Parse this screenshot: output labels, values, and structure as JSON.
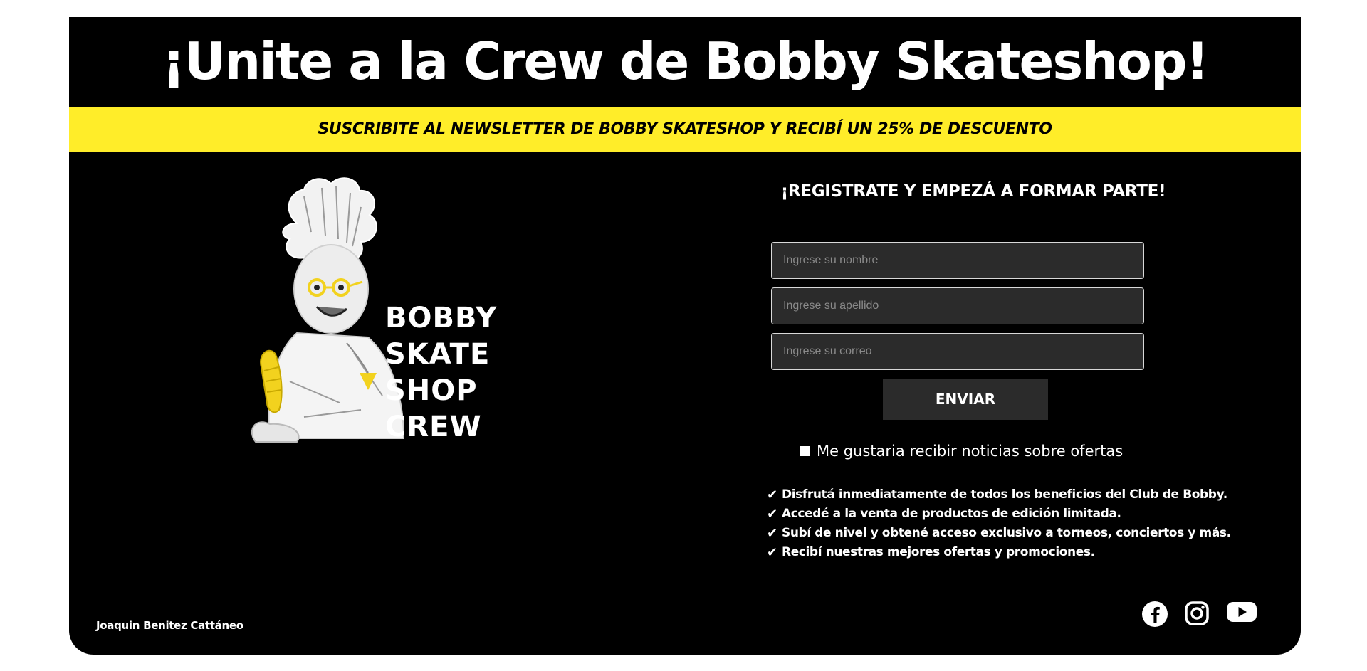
{
  "header": {
    "title": "¡Unite a la Crew de Bobby Skateshop!"
  },
  "banner": {
    "text": "SUSCRIBITE AL NEWSLETTER DE BOBBY SKATESHOP Y RECIBÍ UN 25% DE DESCUENTO",
    "color": "#FFED29"
  },
  "logo": {
    "lines": [
      "BOBBY",
      "SKATE",
      "SHOP",
      "CREW"
    ],
    "accent_color": "#F2D21E"
  },
  "form": {
    "title": "¡REGISTRATE Y EMPEZÁ A FORMAR PARTE!",
    "fields": [
      {
        "placeholder": "Ingrese su nombre",
        "value": ""
      },
      {
        "placeholder": "Ingrese su apellido",
        "value": ""
      },
      {
        "placeholder": "Ingrese su correo",
        "value": ""
      }
    ],
    "submit_label": "ENVIAR",
    "optin_label": "Me gustaria recibir noticias sobre ofertas",
    "optin_checked": false
  },
  "benefits": [
    "Disfrutá inmediatamente de todos los beneficios del Club de Bobby.",
    "Accedé a la venta de productos de edición limitada.",
    "Subí de nivel y obtené acceso exclusivo a torneos, conciertos y más.",
    "Recibí nuestras mejores ofertas y promociones."
  ],
  "footer": {
    "author": "Joaquin Benitez Cattáneo",
    "social_icons": [
      "facebook-icon",
      "instagram-icon",
      "youtube-icon"
    ]
  },
  "colors": {
    "card_bg": "#000000",
    "input_bg": "#2B2B2B",
    "text": "#FFFFFF"
  }
}
